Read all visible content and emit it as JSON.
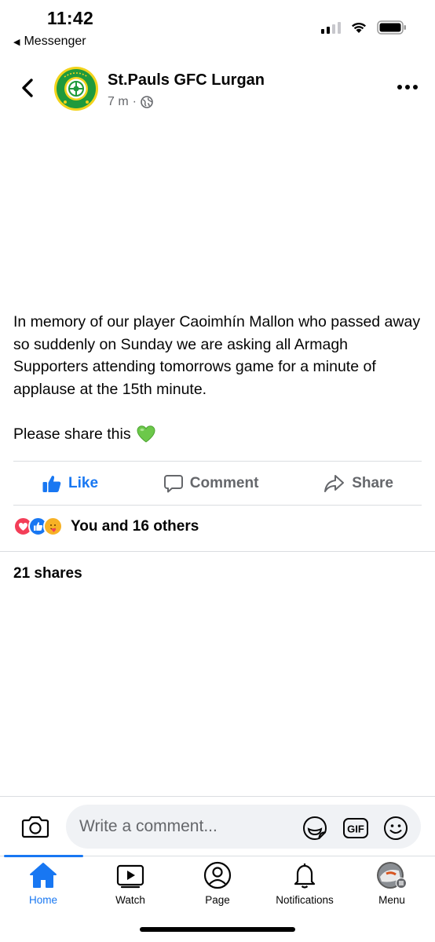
{
  "status_bar": {
    "time": "11:42",
    "back_app": "Messenger",
    "icons": [
      "signal-icon",
      "wifi-icon",
      "battery-icon"
    ]
  },
  "header": {
    "page_name": "St.Pauls GFC Lurgan",
    "time_ago": "7 m",
    "separator": "·",
    "privacy_icon": "globe-icon"
  },
  "post": {
    "text": "In memory of our player Caoimhín Mallon who passed away so suddenly on Sunday we are asking all Armagh Supporters attending tomorrows game for a minute of applause at the 15th minute.",
    "share_line": "Please share this",
    "emoji": "💚"
  },
  "actions": {
    "like": "Like",
    "comment": "Comment",
    "share": "Share"
  },
  "reactions": {
    "icons": [
      "love-icon",
      "like-icon",
      "care-icon"
    ],
    "summary": "You and 16 others"
  },
  "shares": {
    "count_text": "21 shares"
  },
  "comment_bar": {
    "placeholder": "Write a comment...",
    "gif_label": "GIF"
  },
  "tabs": [
    {
      "label": "Home",
      "icon": "home-icon",
      "active": true
    },
    {
      "label": "Watch",
      "icon": "watch-icon",
      "active": false
    },
    {
      "label": "Page",
      "icon": "page-icon",
      "active": false
    },
    {
      "label": "Notifications",
      "icon": "bell-icon",
      "active": false
    },
    {
      "label": "Menu",
      "icon": "menu-icon",
      "active": false
    }
  ],
  "colors": {
    "accent": "#1877f2",
    "secondary_text": "#65676b",
    "avatar_green": "#1f9a3c",
    "avatar_yellow": "#f2d31b"
  }
}
